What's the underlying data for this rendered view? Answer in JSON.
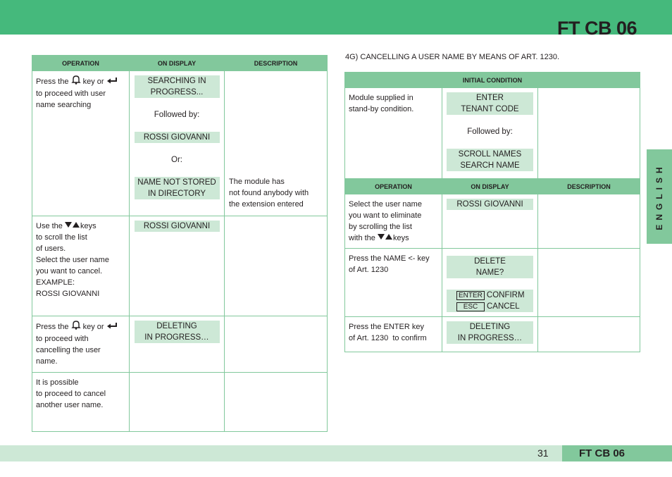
{
  "header": {
    "title": "FT CB 06",
    "accent_color": "#45b97c"
  },
  "side_tab": {
    "label": "ENGLISH",
    "color": "#82c89c"
  },
  "footer": {
    "page_number": "31",
    "title": "FT CB 06",
    "band_color": "#cde8d6",
    "title_bg": "#82c89c"
  },
  "left_table": {
    "headers": [
      "OPERATION",
      "ON DISPLAY",
      "DESCRIPTION"
    ],
    "rows": [
      {
        "operation": {
          "pre": "Press the",
          "mid": "key or",
          "rest": [
            "to proceed with user",
            "name searching"
          ]
        },
        "display": {
          "lcd1": [
            "SEARCHING IN",
            "PROGRESS..."
          ],
          "text1": "Followed by:",
          "lcd2": [
            "ROSSI GIOVANNI"
          ],
          "text2": "Or:",
          "lcd3": [
            "NAME NOT STORED",
            "IN DIRECTORY"
          ]
        },
        "description": [
          "The module has",
          "not found anybody with",
          "the extension entered"
        ]
      },
      {
        "operation": {
          "pre": "Use the",
          "post": "keys",
          "rest": [
            "to scroll the list",
            "of users.",
            "Select the user name",
            "you want to cancel.",
            "EXAMPLE:",
            "ROSSI GIOVANNI"
          ]
        },
        "display": {
          "lcd1": [
            "ROSSI GIOVANNI"
          ]
        },
        "description": []
      },
      {
        "operation": {
          "pre": "Press the",
          "mid": "key or",
          "rest": [
            "to proceed with",
            "cancelling the user",
            "name."
          ]
        },
        "display": {
          "lcd1": [
            "DELETING",
            "IN PROGRESS…"
          ]
        },
        "description": []
      },
      {
        "operation": {
          "rest": [
            "It is possible",
            "to proceed to cancel",
            "another user name."
          ]
        },
        "display": {},
        "description": []
      }
    ]
  },
  "right_section": {
    "title": "4G) CANCELLING A USER NAME BY MEANS OF ART. 1230.",
    "initial_header": "INITIAL CONDITION",
    "initial_row": {
      "operation": [
        "Module supplied in",
        "stand-by condition."
      ],
      "lcd1": [
        "ENTER",
        "TENANT CODE"
      ],
      "text1": "Followed by:",
      "lcd2": [
        "SCROLL NAMES",
        "SEARCH NAME"
      ]
    },
    "headers": [
      "OPERATION",
      "ON DISPLAY",
      "DESCRIPTION"
    ],
    "rows": [
      {
        "operation": {
          "lines": [
            "Select the user name",
            "you want to eliminate",
            "by scrolling the list"
          ],
          "last_pre": "with the",
          "last_post": "keys"
        },
        "lcd1": [
          "ROSSI GIOVANNI"
        ]
      },
      {
        "operation": {
          "lines": [
            "Press the NAME <- key",
            "of Art. 1230"
          ]
        },
        "lcd1": [
          "DELETE",
          "NAME?"
        ],
        "keys": [
          {
            "key": "ENTER",
            "action": "CONFIRM"
          },
          {
            "key": "ESC",
            "action": "CANCEL"
          }
        ]
      },
      {
        "operation": {
          "lines": [
            "Press the ENTER key",
            "of Art. 1230  to confirm"
          ]
        },
        "lcd1": [
          "DELETING",
          "IN PROGRESS…"
        ]
      }
    ]
  },
  "icons": {
    "bell": "bell-icon",
    "enter": "enter-arrow-icon",
    "arrows": "down-up-arrows-icon"
  }
}
